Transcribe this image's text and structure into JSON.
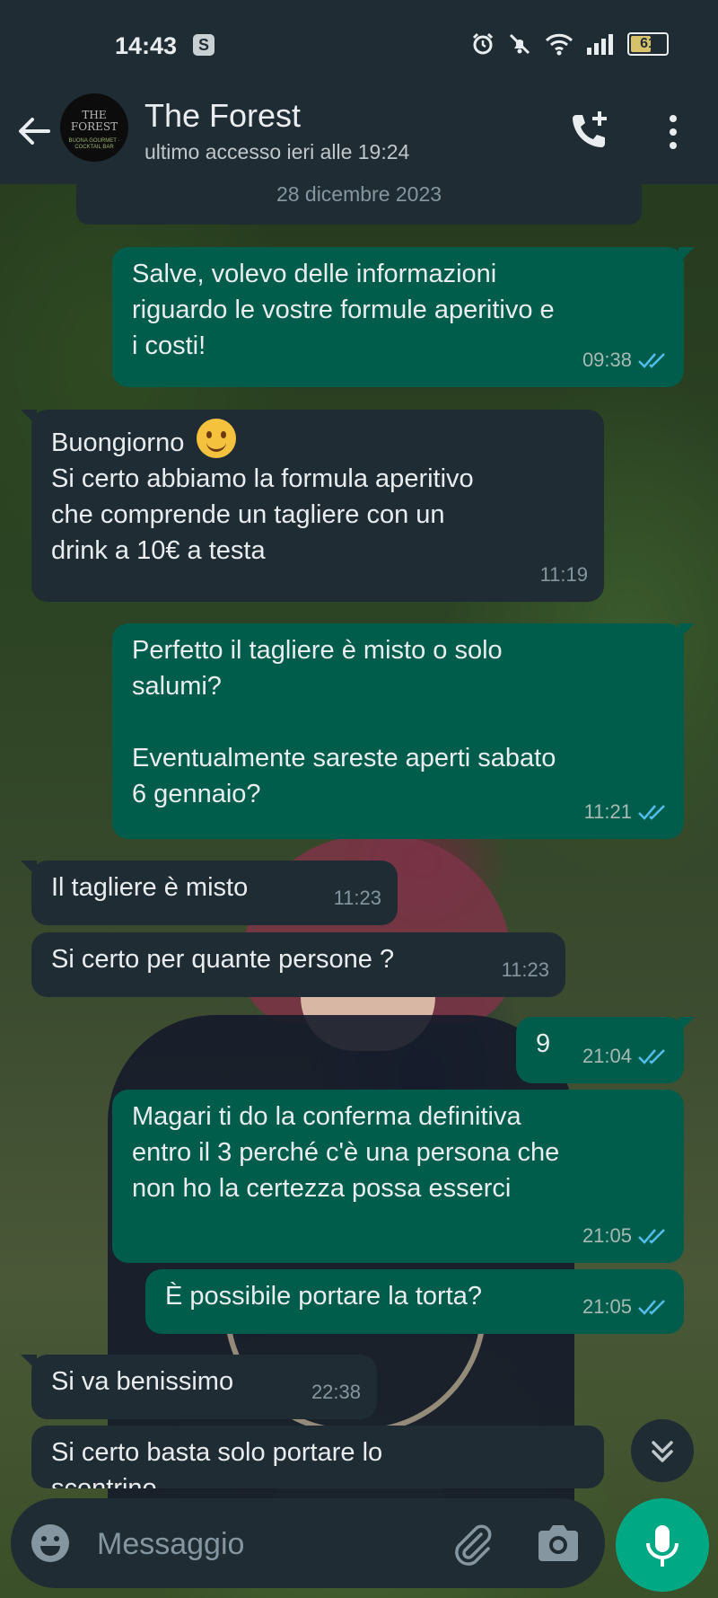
{
  "status_bar": {
    "time": "14:43",
    "app_badge": "S",
    "battery_level": "61"
  },
  "header": {
    "contact_name": "The Forest",
    "last_seen": "ultimo accesso ieri alle 19:24",
    "avatar_line1": "THE",
    "avatar_line2": "FOREST",
    "avatar_line3": "BUONA GOURMET · COCKTAIL BAR"
  },
  "date_separator": "28 dicembre 2023",
  "messages": [
    {
      "dir": "out",
      "text": "Salve, volevo delle informazioni\nriguardo le vostre formule aperitivo e\ni costi!",
      "time": "09:38",
      "read": true
    },
    {
      "dir": "in",
      "text_pre": "Buongiorno ",
      "text": "Si certo abbiamo la formula aperitivo\nche comprende un tagliere con un\ndrink a 10€ a testa",
      "time": "11:19"
    },
    {
      "dir": "out",
      "text": "Perfetto il tagliere è misto o solo\nsalumi?\n\nEventualmente sareste aperti sabato\n6 gennaio?",
      "time": "11:21",
      "read": true
    },
    {
      "dir": "in",
      "text": "Il tagliere è misto",
      "time": "11:23"
    },
    {
      "dir": "in",
      "text": "Si certo per quante persone ?",
      "time": "11:23"
    },
    {
      "dir": "out",
      "text": "9",
      "time": "21:04",
      "read": true
    },
    {
      "dir": "out",
      "text": "Magari ti do la conferma definitiva\nentro il 3 perché c'è una persona che\nnon ho la certezza possa esserci",
      "time": "21:05",
      "read": true
    },
    {
      "dir": "out",
      "text": "È possibile portare la torta?",
      "time": "21:05",
      "read": true
    },
    {
      "dir": "in",
      "text": "Si va benissimo",
      "time": "22:38"
    },
    {
      "dir": "in",
      "text": "Si certo basta solo portare lo\nscontrino",
      "time": ""
    }
  ],
  "composer": {
    "placeholder": "Messaggio"
  },
  "colors": {
    "outgoing": "#005c4b",
    "incoming": "#1f2c34",
    "accent": "#00a884",
    "read_ticks": "#53bdeb"
  },
  "icons": [
    "back-arrow-icon",
    "add-call-icon",
    "more-vert-icon",
    "emoji-icon",
    "attach-icon",
    "camera-icon",
    "mic-icon",
    "scroll-down-icon",
    "alarm-icon",
    "mute-icon",
    "wifi-icon",
    "signal-icon",
    "battery-icon"
  ]
}
